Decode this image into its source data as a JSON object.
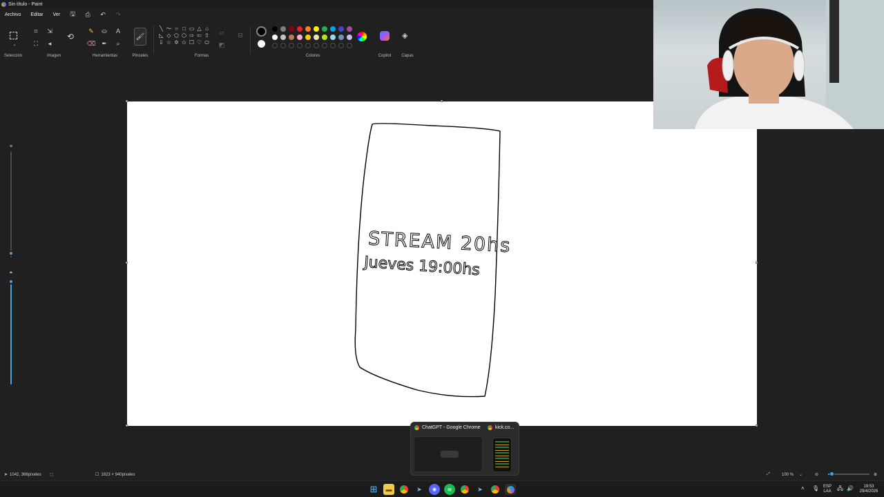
{
  "window": {
    "title": "Sin título - Paint"
  },
  "menu": {
    "file": "Archivo",
    "edit": "Editar",
    "view": "Ver"
  },
  "ribbon": {
    "groups": {
      "selection": "Selección",
      "image": "Imagen",
      "tools": "Herramientas",
      "brushes": "Pinceles",
      "shapes": "Formas",
      "colors": "Colores",
      "copilot": "Copilot",
      "layers": "Capas"
    },
    "shape_glyphs": [
      "╲",
      "〜",
      "○",
      "□",
      "▭",
      "△",
      "⌂",
      "◺",
      "◇",
      "⬠",
      "⬡",
      "⇨",
      "⇦",
      "⇧",
      "⇩",
      "☆",
      "✡",
      "✩",
      "☐",
      "♡",
      "⬭"
    ],
    "palette": [
      "#000000",
      "#7f7f7f",
      "#880015",
      "#ed1c24",
      "#ff7f27",
      "#fff200",
      "#22b14c",
      "#00a2e8",
      "#3f48cc",
      "#a349a4",
      "#ffffff",
      "#c3c3c3",
      "#b97a57",
      "#ffaec9",
      "#ffc90e",
      "#efe4b0",
      "#b5e61d",
      "#99d9ea",
      "#7092be",
      "#c8bfe7",
      "",
      "",
      "",
      "",
      "",
      "",
      "",
      "",
      "",
      ""
    ],
    "primary_color": "#000000",
    "secondary_color": "#ffffff"
  },
  "canvas": {
    "background": "#ffffff",
    "drawing_text_line1": "STREAM 20hs",
    "drawing_text_line2": "Jueves 19:00hs"
  },
  "status": {
    "cursor_position": "1042, 366píxeles",
    "canvas_size": "1823 × 940píxeles",
    "zoom": "100 %"
  },
  "popup": {
    "window1": "ChatGPT - Google Chrome",
    "window2": "kick.co..."
  },
  "taskbar": {
    "language_line1": "ESP",
    "language_line2": "LAA",
    "time": "19:53",
    "date": "29/4/2026"
  },
  "colors": {
    "accent": "#4aa3df",
    "chrome_bg": "#202020"
  }
}
